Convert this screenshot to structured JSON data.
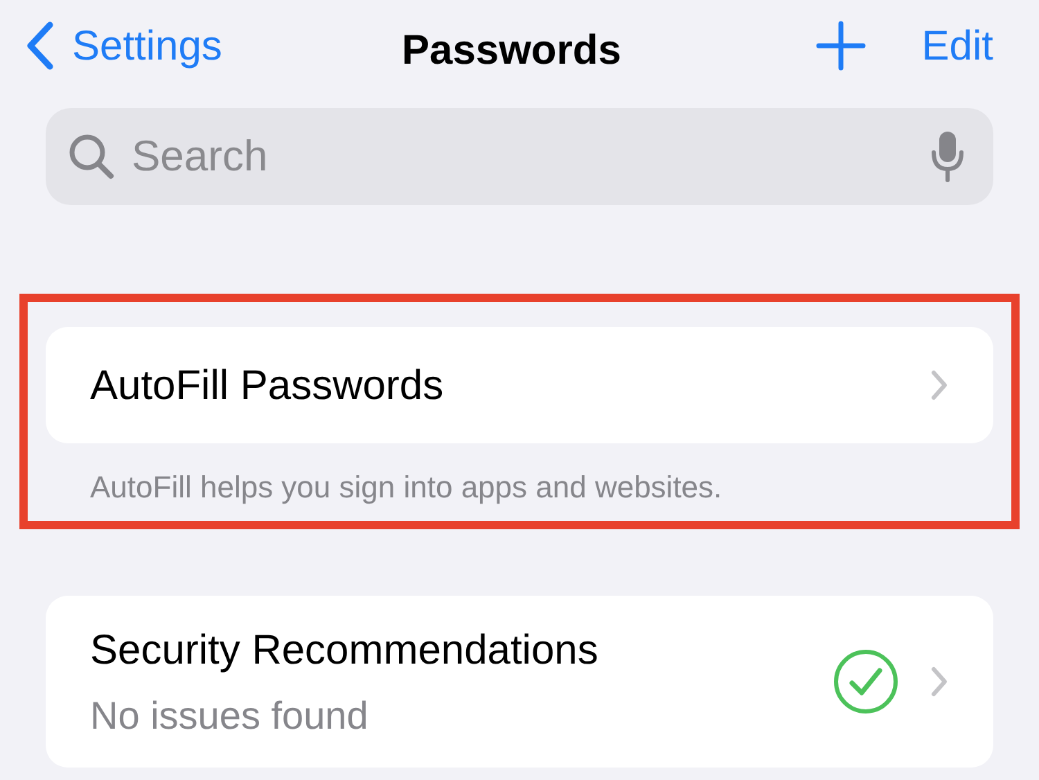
{
  "nav": {
    "back_label": "Settings",
    "title": "Passwords",
    "edit_label": "Edit"
  },
  "search": {
    "placeholder": "Search"
  },
  "autofill": {
    "label": "AutoFill Passwords",
    "footer": "AutoFill helps you sign into apps and websites."
  },
  "security": {
    "title": "Security Recommendations",
    "subtitle": "No issues found"
  }
}
